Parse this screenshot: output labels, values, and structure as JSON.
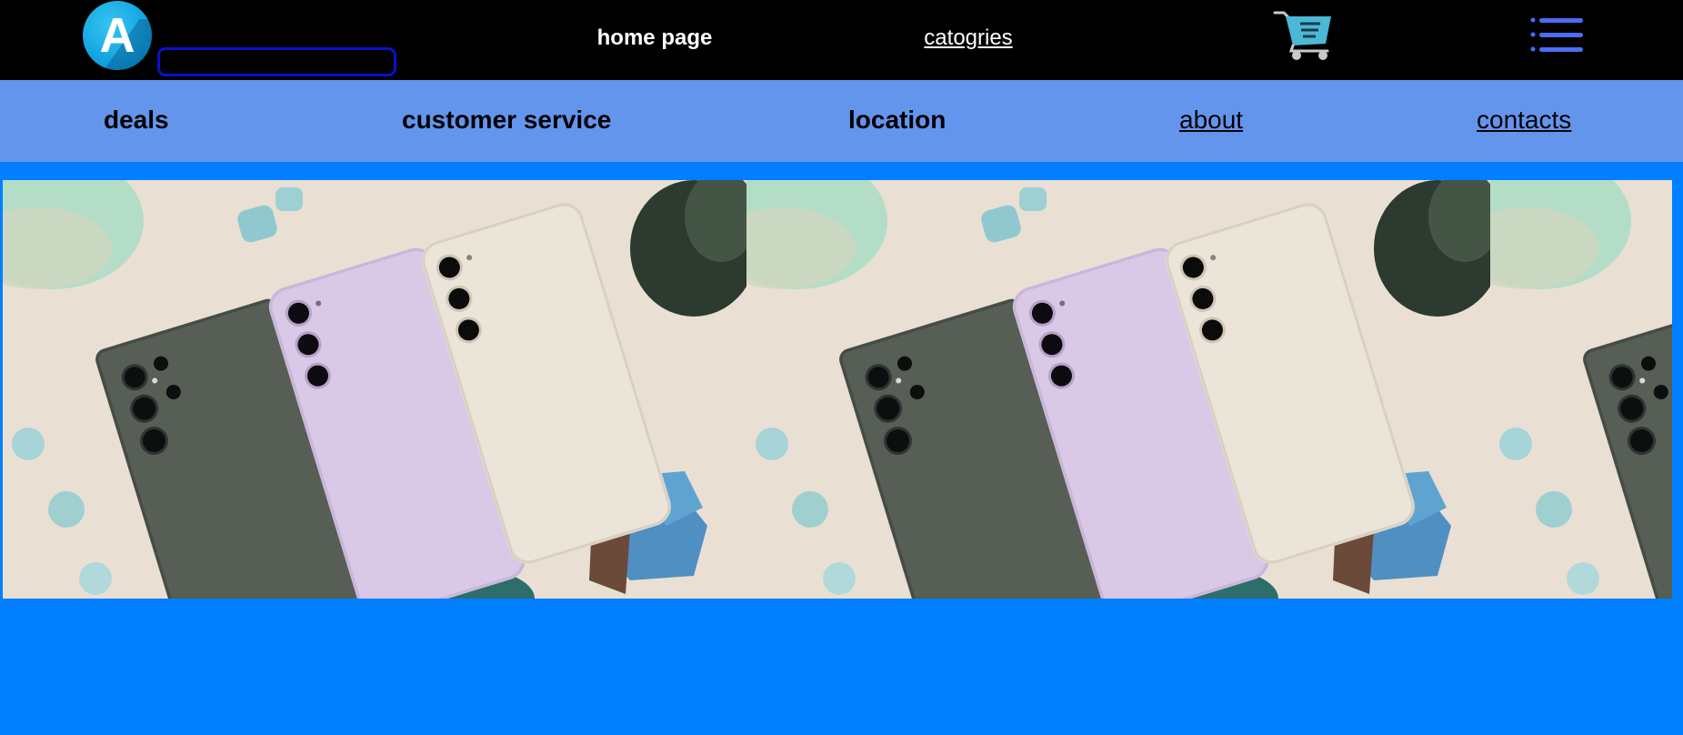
{
  "header": {
    "logo_letter": "A",
    "search": {
      "value": "",
      "placeholder": ""
    },
    "nav": {
      "home": "home page",
      "categories": "catogries"
    }
  },
  "subnav": {
    "items": [
      "deals",
      "customer service",
      "location",
      "about",
      "contacts"
    ]
  },
  "icons": {
    "logo": "logo-icon",
    "cart": "shopping-cart-icon",
    "menu": "hamburger-menu-icon"
  },
  "banner": {
    "image": "three smartphones (dark green, lavender, cream) on beige background, repeated",
    "tile_count": 3
  },
  "colors": {
    "topbar": "#000000",
    "subnav": "#6495ed",
    "page_background": "#007fff",
    "search_border": "#0a10c8",
    "menu_icon": "#4a6cf7",
    "cart_icon": "#4bb8d6"
  }
}
